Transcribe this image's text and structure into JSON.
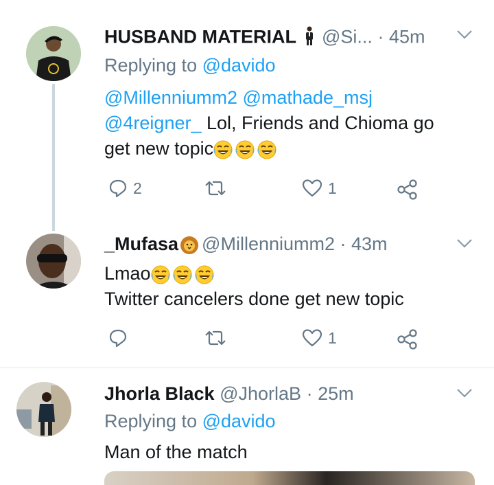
{
  "tweets": [
    {
      "display_name": "HUSBAND MATERIAL",
      "handle": "@Si...",
      "time": "· 45m",
      "replying_prefix": "Replying to ",
      "replying_to": "@davido",
      "mention_line1a": "@Millenniumm2",
      "mention_line1b": "@mathade_msj",
      "mention_line2": "@4reigner_",
      "text_line2": " Lol, Friends and Chioma go",
      "text_line3": "get new topic",
      "replies": "2",
      "likes": "1"
    },
    {
      "display_name": "_Mufasa",
      "handle": "@Millenniumm2",
      "time": "· 43m",
      "text_line1": "Lmao",
      "text_line2": "Twitter cancelers done get new topic",
      "likes": "1"
    },
    {
      "display_name": "Jhorla Black",
      "handle": "@JhorlaB",
      "time": "· 25m",
      "replying_prefix": "Replying to ",
      "replying_to": "@davido",
      "text_line1": "Man of the match"
    }
  ],
  "icons": {
    "reply": "reply-icon",
    "retweet": "retweet-icon",
    "like": "heart-icon",
    "share": "share-icon",
    "chevron": "chevron-down-icon",
    "emoji_laugh": "tears-of-joy-emoji",
    "emoji_lion": "lion-emoji",
    "emoji_man": "man-in-suit-emoji"
  },
  "colors": {
    "link": "#1da1f2",
    "muted": "#657786",
    "text": "#14171a",
    "thread": "#ccd6dd"
  }
}
